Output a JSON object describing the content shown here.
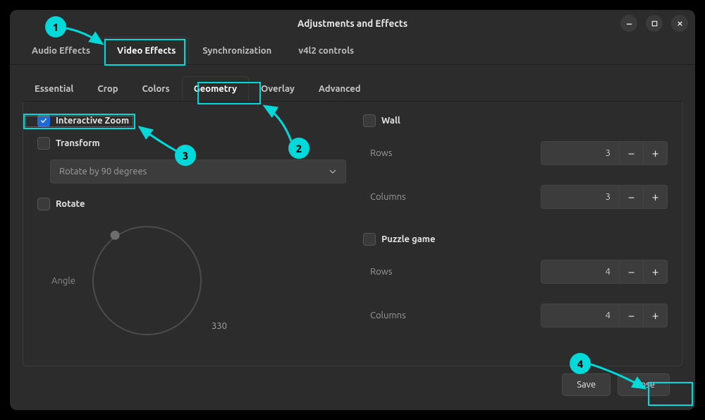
{
  "window": {
    "title": "Adjustments and Effects"
  },
  "tabs": {
    "items": [
      {
        "label": "Audio Effects"
      },
      {
        "label": "Video Effects"
      },
      {
        "label": "Synchronization"
      },
      {
        "label": "v4l2 controls"
      }
    ],
    "active_index": 1
  },
  "subtabs": {
    "items": [
      {
        "label": "Essential"
      },
      {
        "label": "Crop"
      },
      {
        "label": "Colors"
      },
      {
        "label": "Geometry"
      },
      {
        "label": "Overlay"
      },
      {
        "label": "Advanced"
      }
    ],
    "active_index": 3
  },
  "geometry": {
    "interactive_zoom": {
      "label": "Interactive Zoom",
      "checked": true
    },
    "transform": {
      "label": "Transform",
      "checked": false,
      "dropdown_value": "Rotate by 90 degrees"
    },
    "rotate": {
      "label": "Rotate",
      "checked": false,
      "angle_label": "Angle",
      "angle_value": "330"
    },
    "wall": {
      "label": "Wall",
      "checked": false,
      "rows": {
        "label": "Rows",
        "value": "3"
      },
      "columns": {
        "label": "Columns",
        "value": "3"
      }
    },
    "puzzle": {
      "label": "Puzzle game",
      "checked": false,
      "rows": {
        "label": "Rows",
        "value": "4"
      },
      "columns": {
        "label": "Columns",
        "value": "4"
      }
    }
  },
  "buttons": {
    "save": "Save",
    "close": "Close"
  },
  "annotations": {
    "step1": "1",
    "step2": "2",
    "step3": "3",
    "step4": "4"
  },
  "colors": {
    "accent": "#00d9d9",
    "bg": "#2c2c2c"
  }
}
